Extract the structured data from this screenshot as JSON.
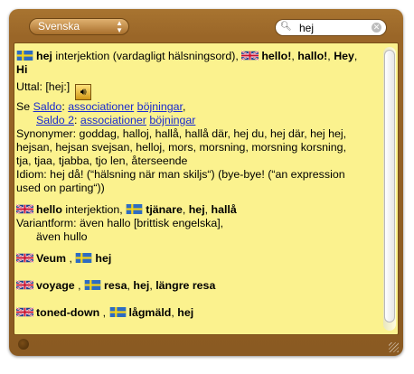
{
  "toolbar": {
    "language": "Svenska",
    "search_value": "hej"
  },
  "entries": {
    "e1": {
      "headword": "hej",
      "pos": "interjektion",
      "gloss": "(vardagligt hälsningsord),",
      "trans_a": "hello!",
      "trans_b": "hallo!",
      "trans_c": "Hey",
      "trans_d": "Hi",
      "uttal": "Uttal: [hej:]",
      "se": "Se",
      "saldo": "Saldo",
      "assoc": "associationer",
      "bojn": "böjningar",
      "saldo2": "Saldo 2",
      "assoc2": "associationer",
      "bojn2": "böjningar",
      "syn1": "Synonymer: goddag, halloj, hallå, hallå där, hej du, hej där, hej hej,",
      "syn2": "hejsan, hejsan svejsan, helloj, mors, morsning, morsning korsning,",
      "syn3": "tja, tjaa, tjabba, tjo len, återseende",
      "idiom1": "Idiom: hej då! (“hälsning när man skiljs“) (bye-bye! (“an expression",
      "idiom2": "used on parting“))"
    },
    "e2": {
      "headword": "hello",
      "pos": "interjektion,",
      "t1": "tjänare",
      "t2": "hej",
      "t3": "hallå",
      "variant": "Variantform: även hallo [brittisk engelska],",
      "variant2": "även hullo"
    },
    "e3": {
      "headword": "Veum",
      "trans": "hej"
    },
    "e4": {
      "headword": "voyage",
      "t1": "resa",
      "t2": "hej",
      "t3": "längre resa"
    },
    "e5": {
      "headword": "toned-down",
      "t1": "lågmäld",
      "t2": "hej"
    }
  },
  "colors": {
    "frame": "#9a6628",
    "panel": "#fbf28e",
    "link": "#1a2bd0"
  }
}
